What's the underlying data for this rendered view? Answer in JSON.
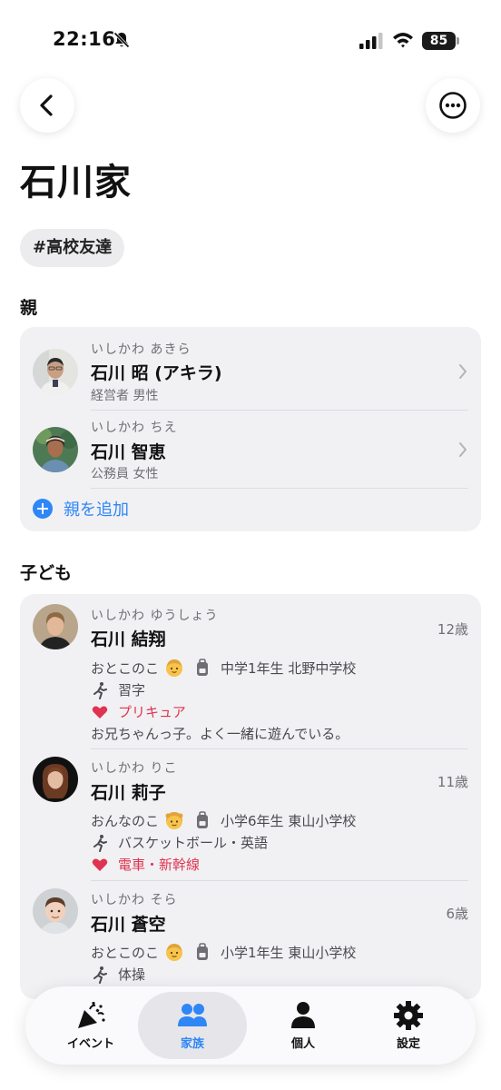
{
  "status_bar": {
    "time": "22:16",
    "battery": "85"
  },
  "header": {
    "title": "石川家"
  },
  "tags": [
    "#高校友達"
  ],
  "parents_section": {
    "label": "親",
    "members": [
      {
        "kana": "いしかわ あきら",
        "name": "石川 昭 (アキラ)",
        "meta": "経営者  男性"
      },
      {
        "kana": "いしかわ ちえ",
        "name": "石川 智恵",
        "meta": "公務員  女性"
      }
    ],
    "add_label": "親を追加"
  },
  "children_section": {
    "label": "子ども",
    "members": [
      {
        "kana": "いしかわ ゆうしょう",
        "name": "石川 結翔",
        "age": "12歳",
        "gender": "おとこのこ",
        "school": "中学1年生  北野中学校",
        "hobbies": "習字",
        "favorites": "プリキュア",
        "note": "お兄ちゃんっ子。よく一緒に遊んでいる。"
      },
      {
        "kana": "いしかわ りこ",
        "name": "石川 莉子",
        "age": "11歳",
        "gender": "おんなのこ",
        "school": "小学6年生  東山小学校",
        "hobbies": "バスケットボール・英語",
        "favorites": "電車・新幹線"
      },
      {
        "kana": "いしかわ そら",
        "name": "石川 蒼空",
        "age": "6歳",
        "gender": "おとこのこ",
        "school": "小学1年生  東山小学校",
        "hobbies": "体操"
      }
    ]
  },
  "tabbar": {
    "tabs": [
      {
        "label": "イベント",
        "icon": "party-popper-icon"
      },
      {
        "label": "家族",
        "icon": "people-icon",
        "active": true
      },
      {
        "label": "個人",
        "icon": "person-icon"
      },
      {
        "label": "設定",
        "icon": "gear-icon"
      }
    ]
  },
  "colors": {
    "accent": "#2f86f6",
    "favorite": "#e0334f",
    "card": "#f1f1f4"
  }
}
